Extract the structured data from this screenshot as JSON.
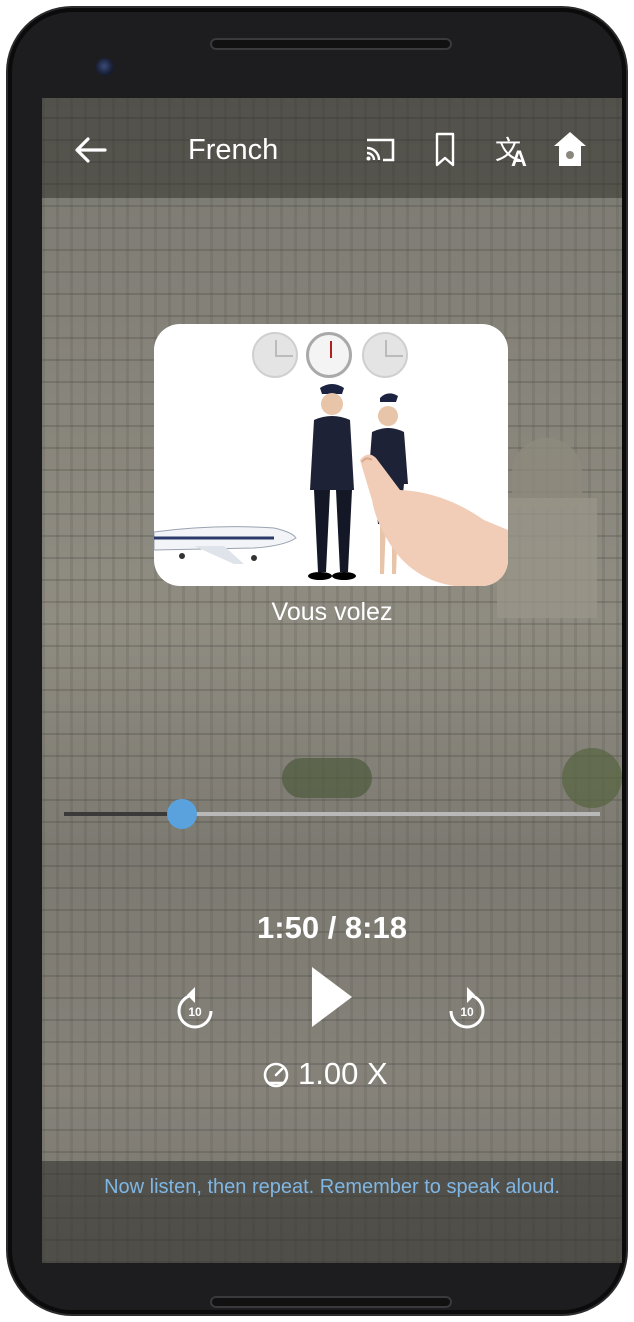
{
  "header": {
    "title": "French",
    "back_icon": "arrow-left-icon",
    "cast_icon": "cast-icon",
    "bookmark_icon": "bookmark-icon",
    "translate_icon": "translate-icon",
    "home_icon": "home-icon"
  },
  "lesson_card": {
    "clocks": [
      "past",
      "present",
      "future"
    ],
    "active_clock": "present",
    "illustration": "pilot-and-flight-attendant-with-airplane"
  },
  "caption": "Vous volez",
  "player": {
    "progress_fraction": 0.2204,
    "time_display": "1:50 / 8:18",
    "rewind_label": "10",
    "forward_label": "10",
    "speed_label": "1.00 X"
  },
  "instruction": "Now listen, then repeat. Remember to speak aloud.",
  "colors": {
    "accent": "#5aa2de",
    "instruction_text": "#7fb6e4",
    "bar_overlay": "rgba(35,35,32,0.45)"
  }
}
